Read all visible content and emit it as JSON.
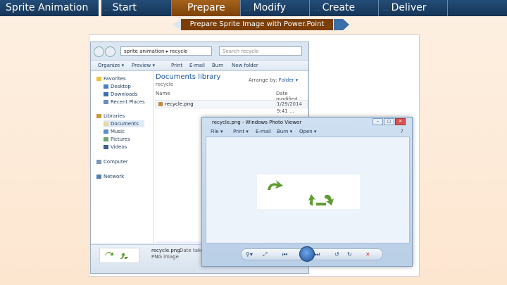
{
  "top_nav": {
    "tabs": [
      {
        "label": "Sprite Animation",
        "dots": ""
      },
      {
        "label": "Start",
        "dots": ". ."
      },
      {
        "label": "Prepare",
        "dots": ""
      },
      {
        "label": "Modify",
        "dots": ". ."
      },
      {
        "label": "Create",
        "dots": ". ."
      },
      {
        "label": "Deliver",
        "dots": ". ."
      }
    ],
    "active_tab": "Prepare",
    "subtitle": "Prepare Sprite Image with Power.Point"
  },
  "explorer": {
    "address": "sprite animation  ▸  recycle",
    "search_placeholder": "Search recycle",
    "toolbar": [
      "Organize ▾",
      "Preview ▾",
      "Print",
      "E-mail",
      "Burn",
      "New folder"
    ],
    "nav_items": [
      {
        "label": "Favorites",
        "icon": "star-icon",
        "indent": false
      },
      {
        "label": "Desktop",
        "icon": "desktop-icon",
        "indent": true
      },
      {
        "label": "Downloads",
        "icon": "downloads-icon",
        "indent": true
      },
      {
        "label": "Recent Places",
        "icon": "recent-icon",
        "indent": true
      },
      {
        "label": "Libraries",
        "icon": "library-icon",
        "indent": false
      },
      {
        "label": "Documents",
        "icon": "documents-icon",
        "indent": true
      },
      {
        "label": "Music",
        "icon": "music-icon",
        "indent": true
      },
      {
        "label": "Pictures",
        "icon": "pictures-icon",
        "indent": true
      },
      {
        "label": "Videos",
        "icon": "videos-icon",
        "indent": true
      },
      {
        "label": "Computer",
        "icon": "computer-icon",
        "indent": false
      },
      {
        "label": "Network",
        "icon": "network-icon",
        "indent": false
      }
    ],
    "library_title": "Documents library",
    "library_sub": "recycle",
    "arrange_label": "Arrange by:",
    "arrange_value": "Folder ▾",
    "columns": [
      "Name",
      "Date modified"
    ],
    "files": [
      {
        "name": "recycle.png",
        "date": "1/29/2014 9:41 ..."
      }
    ],
    "details_name": "recycle.png",
    "details_meta": "Date taken:",
    "details_type": "PNG image"
  },
  "photo_viewer": {
    "title": "recycle.png - Windows Photo Viewer",
    "menu": [
      "File ▾",
      "Print ▾",
      "E-mail",
      "Burn ▾",
      "Open ▾"
    ],
    "help": "?"
  },
  "colors": {
    "nav_bg": "#1c416a",
    "active_tab": "#8e4f10",
    "subtitle_bg": "#7c3e07",
    "arrow_green": "#5f9b2f"
  }
}
